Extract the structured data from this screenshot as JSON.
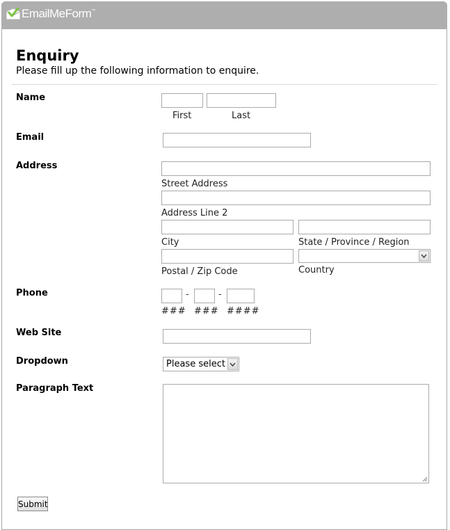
{
  "brand": {
    "name": "EmailMeForm",
    "trademark": "™"
  },
  "form": {
    "title": "Enquiry",
    "description": "Please fill up the following information to enquire.",
    "name": {
      "label": "Name",
      "first_caption": "First",
      "last_caption": "Last",
      "first_value": "",
      "last_value": ""
    },
    "email": {
      "label": "Email",
      "value": ""
    },
    "address": {
      "label": "Address",
      "street_caption": "Street Address",
      "line2_caption": "Address Line 2",
      "city_caption": "City",
      "state_caption": "State / Province / Region",
      "postal_caption": "Postal / Zip Code",
      "country_caption": "Country",
      "country_value": ""
    },
    "phone": {
      "label": "Phone",
      "separator": "-",
      "area_hint": "###",
      "prefix_hint": "###",
      "line_hint": "####"
    },
    "website": {
      "label": "Web Site",
      "value": ""
    },
    "dropdown": {
      "label": "Dropdown",
      "selected": "Please select"
    },
    "paragraph": {
      "label": "Paragraph Text",
      "value": ""
    },
    "submit_label": "Submit"
  },
  "colors": {
    "header_bar": "#aeaeae",
    "logo_green": "#7dc242",
    "border": "#aaaaaa"
  },
  "icons": {
    "logo": "envelope-check-icon",
    "dropdown_arrow": "chevron-down-icon",
    "resize": "resize-grip-icon"
  }
}
